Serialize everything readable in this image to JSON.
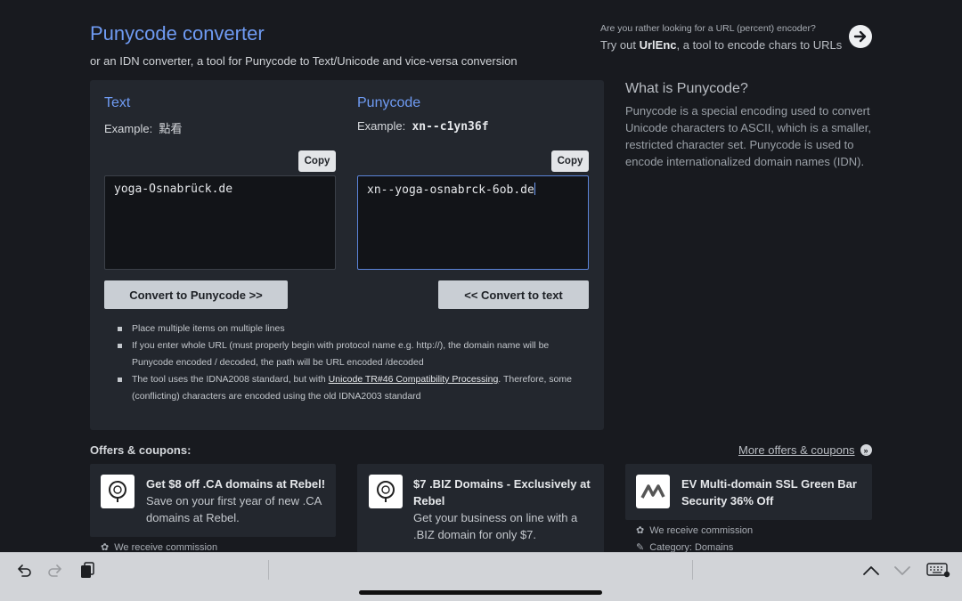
{
  "header": {
    "title": "Punycode converter",
    "subtitle": "or an IDN converter, a tool for Punycode to Text/Unicode and vice-versa conversion",
    "promo_question": "Are you rather looking for a URL (percent) encoder?",
    "promo_prefix": "Try out ",
    "promo_link": "UrlEnc",
    "promo_suffix": ", a tool to encode chars to URLs"
  },
  "text_col": {
    "title": "Text",
    "example_label": "Example:",
    "example_value": "點看",
    "copy_label": "Copy",
    "value": "yoga-Osnabrück.de",
    "convert_label": "Convert to Punycode >>"
  },
  "puny_col": {
    "title": "Punycode",
    "example_label": "Example:",
    "example_value": "xn--c1yn36f",
    "copy_label": "Copy",
    "value": "xn--yoga-osnabrck-6ob.de",
    "convert_label": "<< Convert to text"
  },
  "notes": {
    "n1": "Place multiple items on multiple lines",
    "n2": "If you enter whole URL (must properly begin with protocol name e.g. http://), the domain name will be Punycode encoded / decoded, the path will be URL encoded /decoded",
    "n3_prefix": "The tool uses the IDNA2008 standard, but with ",
    "n3_link": "Unicode TR#46 Compatibility Processing",
    "n3_suffix": ". Therefore, some (conflicting) characters are encoded using the old IDNA2003 standard"
  },
  "sidebar": {
    "heading": "What is Punycode?",
    "body": "Punycode is a special encoding used to convert Unicode characters to ASCII, which is a smaller, restricted character set. Punycode is used to encode internationalized domain names (IDN)."
  },
  "offers": {
    "heading": "Offers & coupons:",
    "more_label": "More offers & coupons",
    "cards": [
      {
        "title": "Get $8 off .CA domains at Rebel!",
        "desc": "Save on your first year of new .CA domains at Rebel.",
        "meta1": "We receive commission"
      },
      {
        "title": "$7 .BIZ Domains - Exclusively at Rebel",
        "desc": "Get your business on line with a .BIZ domain for only $7."
      },
      {
        "title": "EV Multi-domain SSL Green Bar Security 36% Off",
        "meta1": "We receive commission",
        "meta2": "Category: Domains"
      }
    ]
  },
  "icons": {
    "promo": "arrow-right-circle-icon",
    "undo": "undo-icon",
    "redo": "redo-icon",
    "paste": "clipboard-icon",
    "up": "chevron-up-icon",
    "down": "chevron-down-icon",
    "keyboard": "keyboard-icon"
  }
}
